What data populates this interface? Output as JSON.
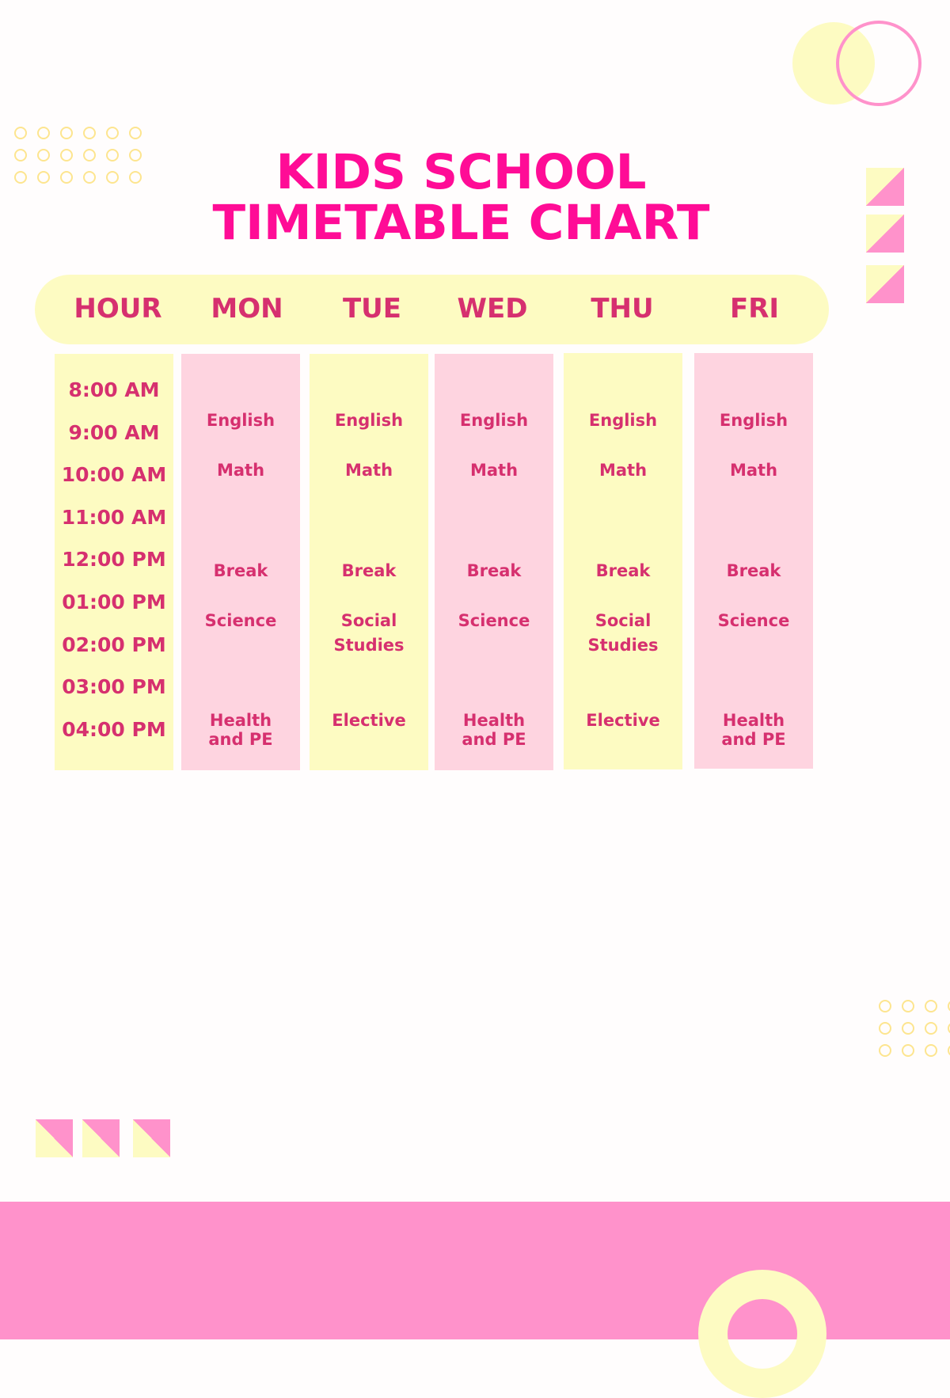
{
  "title": {
    "line1": "KIDS SCHOOL",
    "line2": "TIMETABLE CHART"
  },
  "header": [
    "HOUR",
    "MON",
    "TUE",
    "WED",
    "THU",
    "FRI"
  ],
  "hours": [
    "8:00 AM",
    "9:00 AM",
    "10:00 AM",
    "11:00 AM",
    "12:00 PM",
    "01:00 PM",
    "02:00 PM",
    "03:00 PM",
    "04:00 PM"
  ],
  "schedule": {
    "MON": {
      "slot1": "English",
      "slot2": "Math",
      "slot3": "Break",
      "slot4": "Science",
      "slot5a": "Health",
      "slot5b": "and PE"
    },
    "TUE": {
      "slot1": "English",
      "slot2": "Math",
      "slot3": "Break",
      "slot4a": "Social",
      "slot4b": "Studies",
      "slot5": "Elective"
    },
    "WED": {
      "slot1": "English",
      "slot2": "Math",
      "slot3": "Break",
      "slot4": "Science",
      "slot5a": "Health",
      "slot5b": "and PE"
    },
    "THU": {
      "slot1": "English",
      "slot2": "Math",
      "slot3": "Break",
      "slot4a": "Social",
      "slot4b": "Studies",
      "slot5": "Elective"
    },
    "FRI": {
      "slot1": "English",
      "slot2": "Math",
      "slot3": "Break",
      "slot4": "Science",
      "slot5a": "Health",
      "slot5b": "and PE"
    }
  },
  "colors": {
    "title": "#ff0c96",
    "text": "#d6306f",
    "yellow": "#fdfbc2",
    "pink_light": "#fed4e0",
    "pink": "#ff92cb",
    "dot_outline": "#fde58f"
  }
}
